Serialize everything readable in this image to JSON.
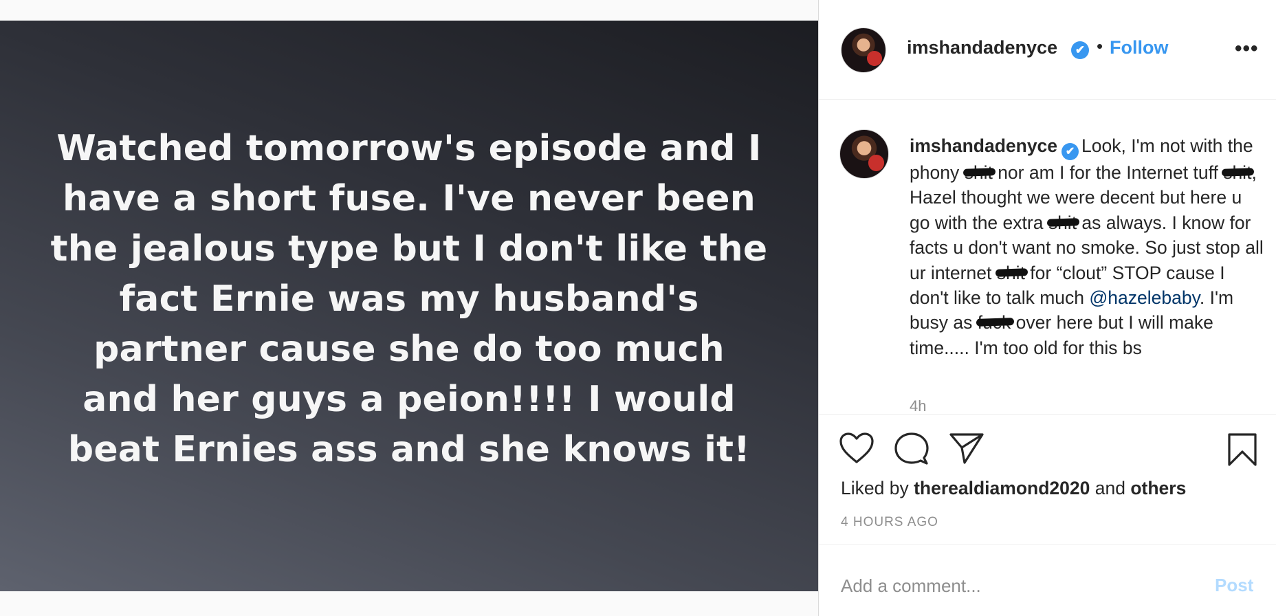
{
  "post": {
    "image_text": "Watched tomorrow's episode and I\nhave a short fuse. I've never been\nthe jealous type but I don't like the\nfact Ernie was my husband's\npartner cause she do too much\nand her guys a peion!!!! I would\nbeat Ernies ass and she knows it!"
  },
  "header": {
    "username": "imshandadenyce",
    "verified_icon": "✔",
    "separator": "•",
    "follow_label": "Follow",
    "more_icon": "•••"
  },
  "caption": {
    "username": "imshandadenyce",
    "verified_icon": "✔",
    "seg1": "Look, I'm not with the phony ",
    "redacted1": "shit",
    "seg2": " nor am I for the Internet tuff ",
    "redacted2": "shit",
    "seg3": ", Hazel thought we were decent but here u go with the extra ",
    "redacted3": "shit",
    "seg4": " as always. I know for facts u don't want no smoke. So just stop all ur internet ",
    "redacted4": "shit",
    "seg5": " for “clout” STOP cause I don't like to talk much ",
    "mention": "@hazelebaby",
    "seg6": ". I'm busy as ",
    "redacted5": "fuck",
    "seg7": " over here but I will make time..... I'm too old for this bs",
    "timestamp": "4h"
  },
  "actions": {
    "liked_by_prefix": "Liked by ",
    "liked_by_user": "therealdiamond2020",
    "liked_by_middle": " and ",
    "liked_by_others": "others",
    "time_ago": "4 HOURS AGO"
  },
  "comment": {
    "placeholder": "Add a comment...",
    "post_label": "Post"
  },
  "colors": {
    "accent": "#3897f0",
    "mention": "#003569",
    "muted": "#8e8e8e",
    "post_disabled": "#b3dbff"
  }
}
